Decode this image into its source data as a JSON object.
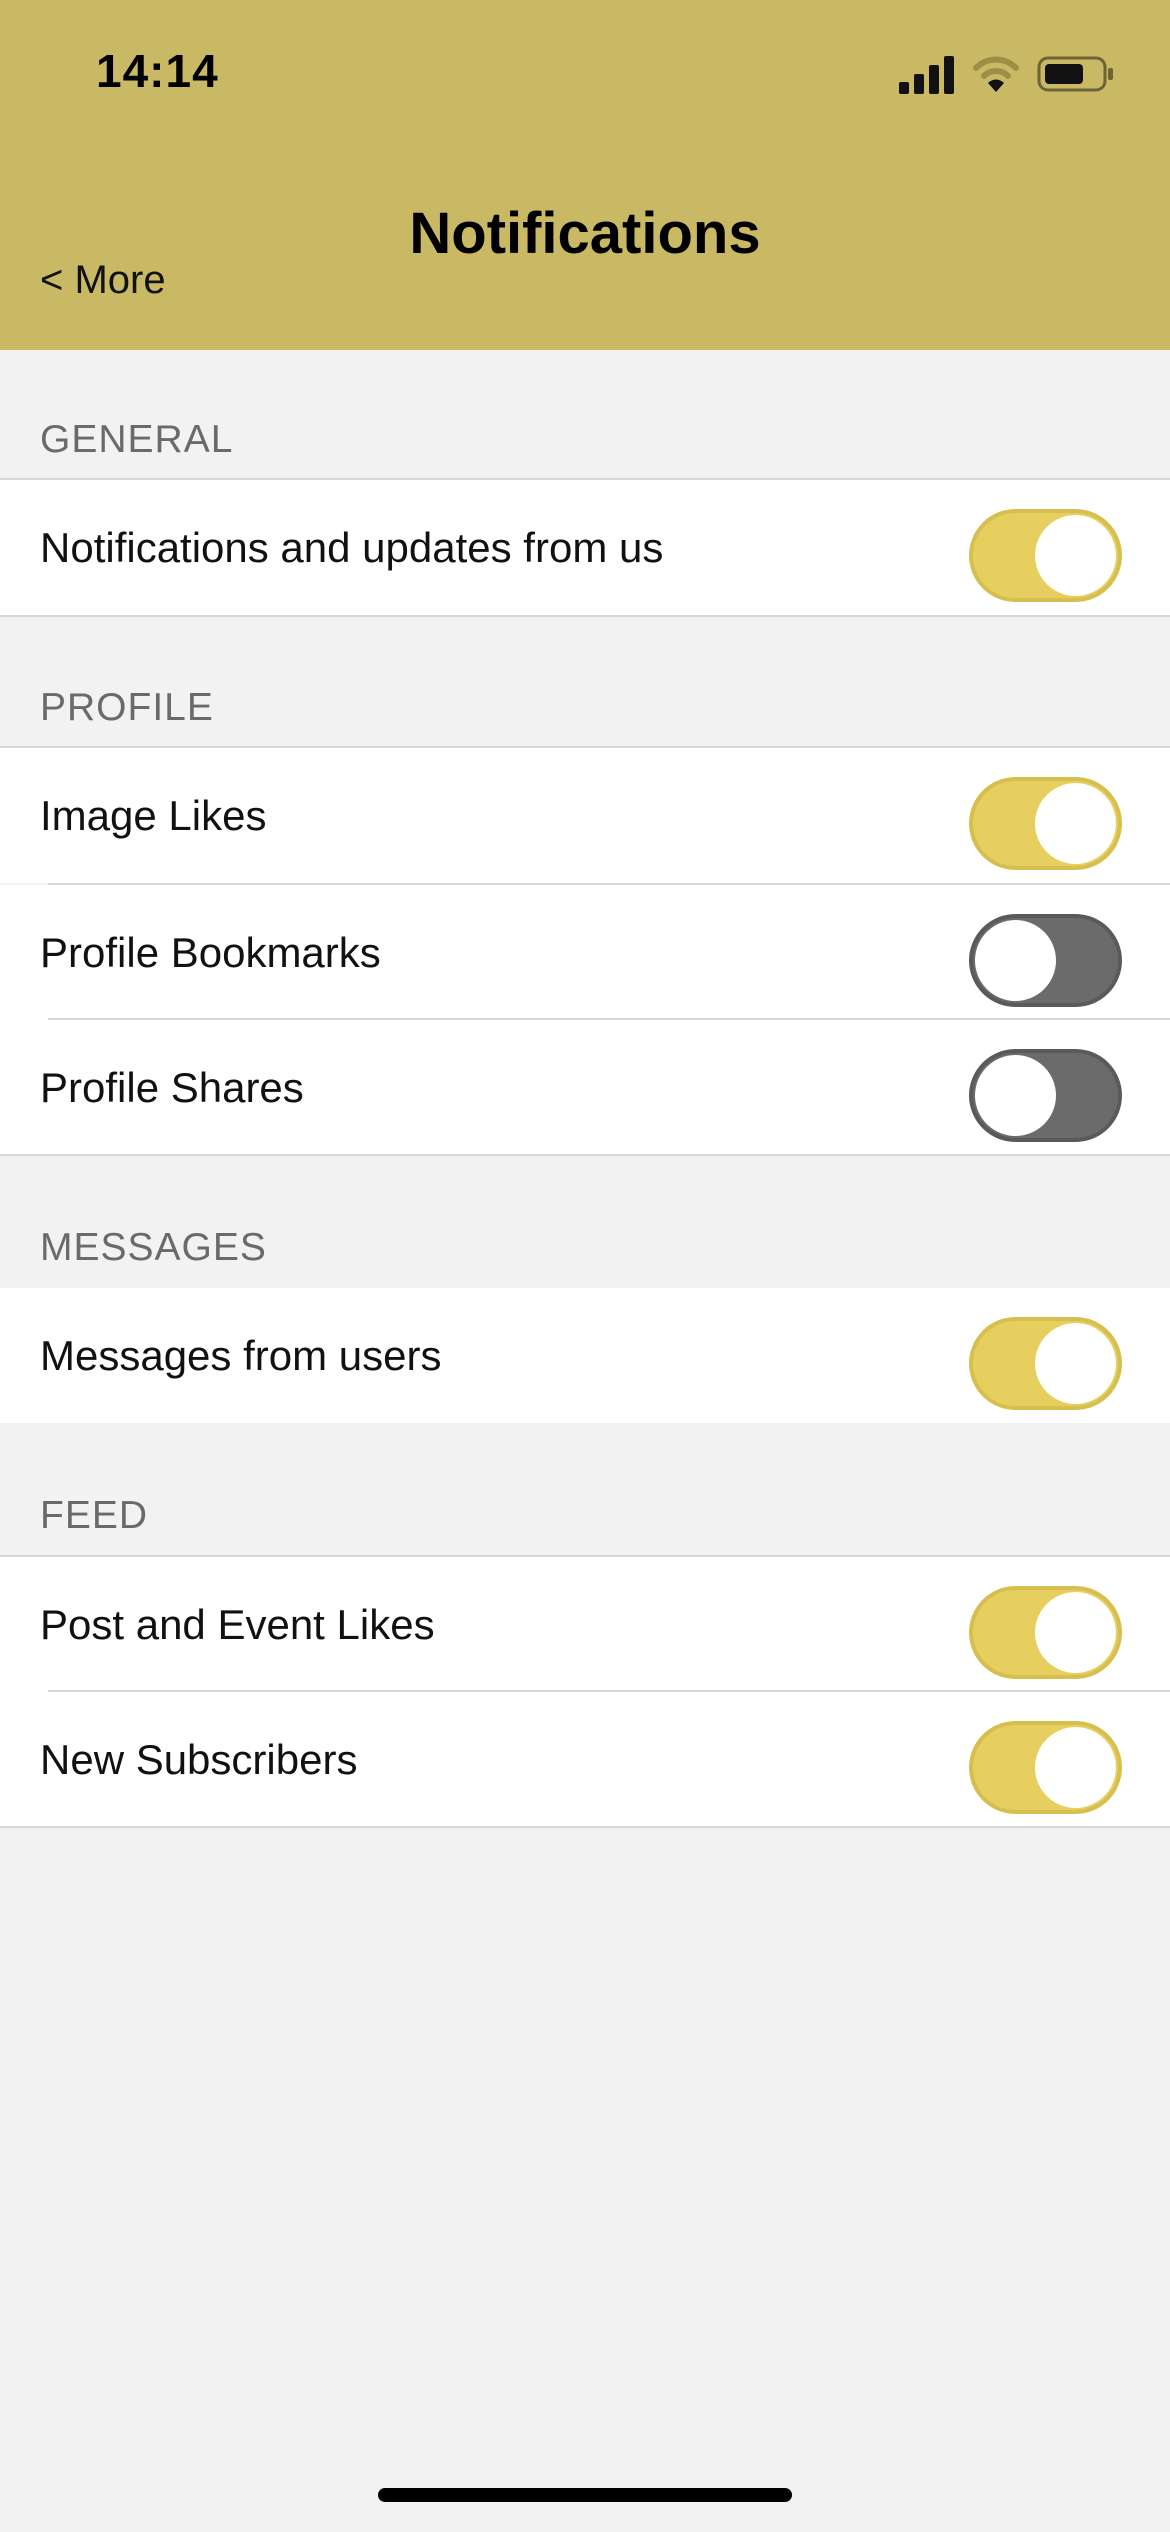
{
  "status_bar": {
    "time": "14:14",
    "icons": [
      "signal-icon",
      "wifi-icon",
      "battery-icon"
    ]
  },
  "nav": {
    "title": "Notifications",
    "back_label": "< More"
  },
  "colors": {
    "header_bg": "#c9b965",
    "toggle_on": "#e6cf5e",
    "toggle_off": "#6b6b6b",
    "page_bg": "#f2f2f2"
  },
  "sections": {
    "general": {
      "header": "GENERAL",
      "items": [
        {
          "label": "Notifications and updates from us",
          "enabled": true
        }
      ]
    },
    "profile": {
      "header": "PROFILE",
      "items": [
        {
          "label": "Image Likes",
          "enabled": true
        },
        {
          "label": "Profile Bookmarks",
          "enabled": false
        },
        {
          "label": "Profile Shares",
          "enabled": false
        }
      ]
    },
    "messages": {
      "header": "MESSAGES",
      "items": [
        {
          "label": "Messages from users",
          "enabled": true
        }
      ]
    },
    "feed": {
      "header": "FEED",
      "items": [
        {
          "label": "Post and Event Likes",
          "enabled": true
        },
        {
          "label": "New Subscribers",
          "enabled": true
        }
      ]
    }
  }
}
